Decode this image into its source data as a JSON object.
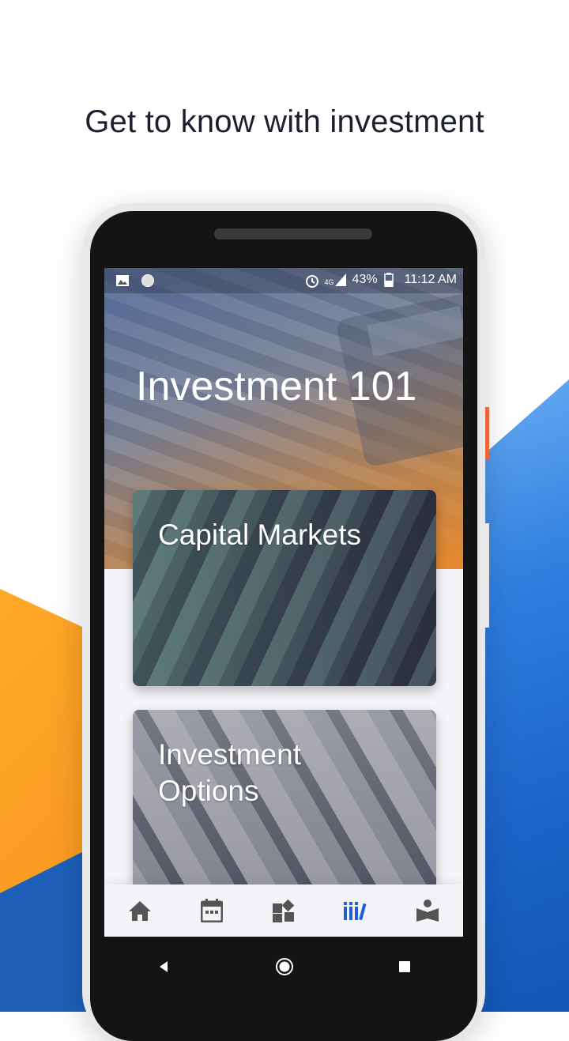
{
  "headline": "Get to know with investment",
  "colors": {
    "accent_orange": "#f7931e",
    "accent_blue": "#1c64c8",
    "nav_active": "#1f5fd6",
    "nav_inactive": "#555555"
  },
  "status_bar": {
    "left_icons": [
      "image-icon",
      "circle-notification-icon"
    ],
    "alarm_icon": "alarm-icon",
    "network": "4G",
    "battery": "43%",
    "time": "11:12 AM"
  },
  "hero": {
    "title": "Investment 101"
  },
  "cards": [
    {
      "title": "Capital Markets"
    },
    {
      "title": "Investment\nOptions"
    }
  ],
  "bottom_nav": [
    {
      "icon": "home-icon",
      "active": false
    },
    {
      "icon": "calendar-icon",
      "active": false
    },
    {
      "icon": "dashboard-icon",
      "active": false
    },
    {
      "icon": "library-icon",
      "active": true
    },
    {
      "icon": "reader-icon",
      "active": false
    }
  ],
  "system_nav": [
    "back-icon",
    "home-circle-icon",
    "recents-icon"
  ]
}
